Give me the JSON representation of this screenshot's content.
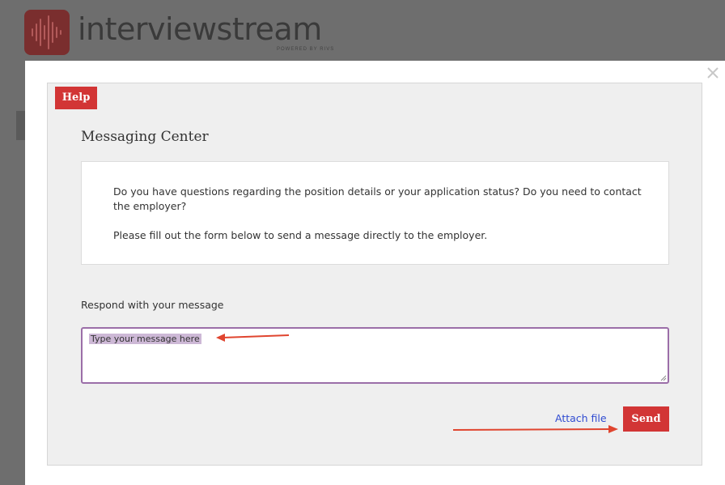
{
  "brand": {
    "name": "interviewstream",
    "tagline": "POWERED BY RIVS",
    "accent": "#d23535",
    "logo_color": "#7a2e2e"
  },
  "modal": {
    "close_icon": "close-icon",
    "help_label": "Help",
    "title": "Messaging Center",
    "info": {
      "paragraph1": "Do you have questions regarding the position details or your application status? Do you need to contact the employer?",
      "paragraph2": "Please fill out the form below to send a message directly to the employer."
    },
    "form": {
      "label": "Respond with your message",
      "message_placeholder": "Type your message here",
      "attach_label": "Attach file",
      "send_label": "Send"
    },
    "annotation_color": "#e0452f"
  }
}
